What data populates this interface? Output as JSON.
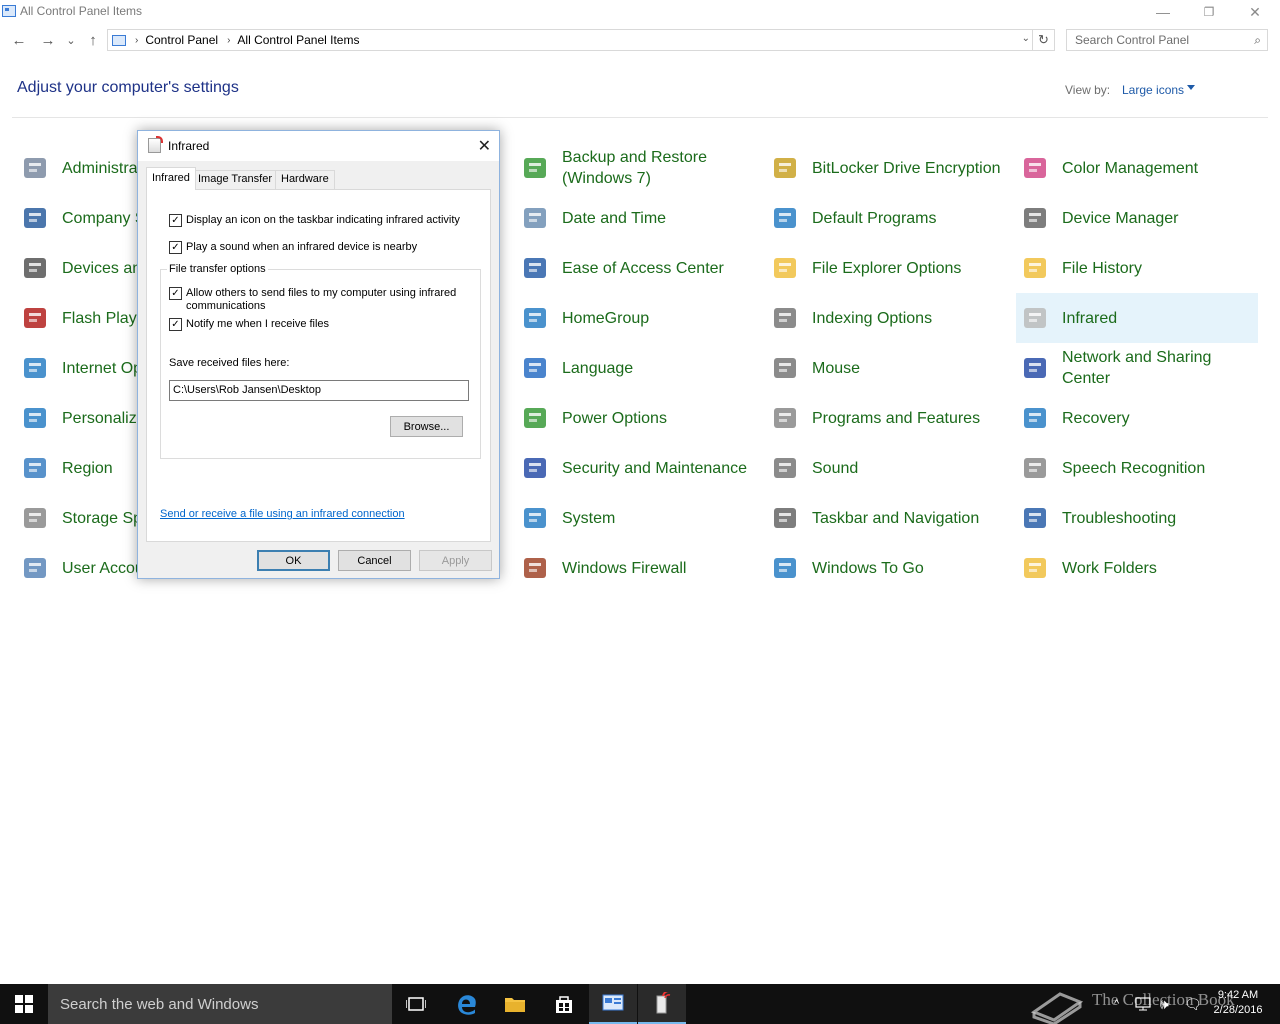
{
  "window": {
    "title": "All Control Panel Items",
    "minimize_glyph": "—",
    "restore_glyph": "❐",
    "close_glyph": "✕"
  },
  "nav": {
    "back_glyph": "←",
    "forward_glyph": "→",
    "recent_glyph": "⌄",
    "up_glyph": "↑",
    "breadcrumbs": [
      "Control Panel",
      "All Control Panel Items"
    ],
    "search_placeholder": "Search Control Panel",
    "refresh_glyph": "↻"
  },
  "header": {
    "heading": "Adjust your computer's settings",
    "view_by_label": "View by:",
    "view_by_value": "Large icons"
  },
  "items": [
    {
      "label": "Administrative Tools",
      "icon": "admin-tools-icon"
    },
    {
      "label": "Company Settings",
      "icon": "company-icon"
    },
    {
      "label": "Devices and Printers",
      "icon": "printer-icon"
    },
    {
      "label": "Flash Player",
      "icon": "flash-icon"
    },
    {
      "label": "Internet Options",
      "icon": "globe-icon"
    },
    {
      "label": "Personalization",
      "icon": "personalization-icon"
    },
    {
      "label": "Region",
      "icon": "region-icon"
    },
    {
      "label": "Storage Spaces",
      "icon": "storage-icon"
    },
    {
      "label": "User Accounts",
      "icon": "users-icon"
    },
    {
      "label": "Backup and Restore (Windows 7)",
      "icon": "backup-icon"
    },
    {
      "label": "Date and Time",
      "icon": "calendar-icon"
    },
    {
      "label": "Ease of Access Center",
      "icon": "ease-of-access-icon"
    },
    {
      "label": "HomeGroup",
      "icon": "homegroup-icon"
    },
    {
      "label": "Language",
      "icon": "language-icon"
    },
    {
      "label": "Power Options",
      "icon": "power-icon"
    },
    {
      "label": "Security and Maintenance",
      "icon": "flag-icon"
    },
    {
      "label": "System",
      "icon": "system-icon"
    },
    {
      "label": "Windows Firewall",
      "icon": "firewall-icon"
    },
    {
      "label": "BitLocker Drive Encryption",
      "icon": "bitlocker-icon"
    },
    {
      "label": "Default Programs",
      "icon": "default-programs-icon"
    },
    {
      "label": "File Explorer Options",
      "icon": "folder-options-icon"
    },
    {
      "label": "Indexing Options",
      "icon": "indexing-icon"
    },
    {
      "label": "Mouse",
      "icon": "mouse-icon"
    },
    {
      "label": "Programs and Features",
      "icon": "programs-icon"
    },
    {
      "label": "Sound",
      "icon": "speaker-icon"
    },
    {
      "label": "Taskbar and Navigation",
      "icon": "taskbar-icon"
    },
    {
      "label": "Windows To Go",
      "icon": "usb-icon"
    },
    {
      "label": "Color Management",
      "icon": "color-icon"
    },
    {
      "label": "Device Manager",
      "icon": "device-manager-icon"
    },
    {
      "label": "File History",
      "icon": "file-history-icon"
    },
    {
      "label": "Infrared",
      "icon": "infrared-icon"
    },
    {
      "label": "Network and Sharing Center",
      "icon": "network-icon"
    },
    {
      "label": "Recovery",
      "icon": "recovery-icon"
    },
    {
      "label": "Speech Recognition",
      "icon": "microphone-icon"
    },
    {
      "label": "Troubleshooting",
      "icon": "troubleshoot-icon"
    },
    {
      "label": "Work Folders",
      "icon": "work-folders-icon"
    }
  ],
  "dialog": {
    "title": "Infrared",
    "close_glyph": "✕",
    "tabs": [
      "Infrared",
      "Image Transfer",
      "Hardware"
    ],
    "checkboxes": {
      "display_icon": {
        "label": "Display an icon on the taskbar indicating infrared activity",
        "checked": "✓"
      },
      "play_sound": {
        "label": "Play a sound when an infrared device is nearby",
        "checked": "✓"
      },
      "allow_send": {
        "label": "Allow others to send files to my computer using infrared communications",
        "checked": "✓"
      },
      "notify": {
        "label": "Notify me when I receive files",
        "checked": "✓"
      }
    },
    "group_label": "File transfer options",
    "save_label": "Save received files here:",
    "save_path": "C:\\Users\\Rob Jansen\\Desktop",
    "browse_label": "Browse...",
    "link_text": "Send or receive a file using an infrared connection",
    "ok_label": "OK",
    "cancel_label": "Cancel",
    "apply_label": "Apply"
  },
  "taskbar": {
    "search_placeholder": "Search the web and Windows",
    "time": "9:42 AM",
    "date": "2/28/2016",
    "watermark": "The Collection Book",
    "tray_chevron": "^",
    "volume_glyph": "🕪",
    "notification_glyph": "🗨"
  },
  "colors": {
    "link_green": "#1b6b1b",
    "heading_blue": "#1e3287",
    "selection": "#e5f3fb",
    "taskbar": "#101010"
  }
}
